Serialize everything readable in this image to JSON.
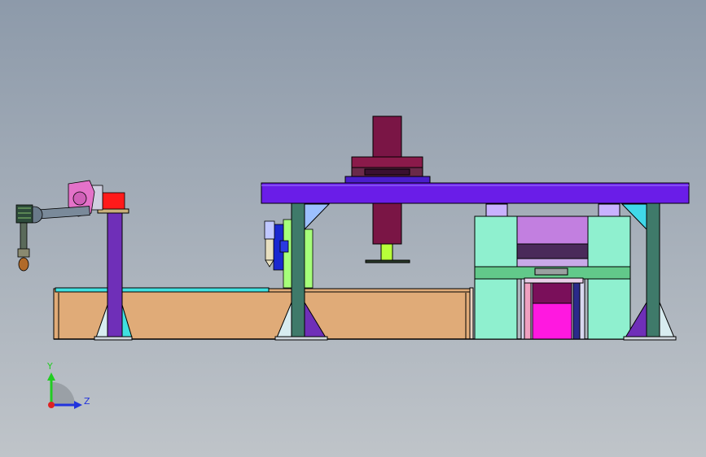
{
  "view": {
    "background_top": "#8d9aaa",
    "background_bottom": "#bfc4c9"
  },
  "triad": {
    "y_label": "Y",
    "z_label": "Z",
    "y_color": "#22cc22",
    "z_color": "#2233dd",
    "origin_color": "#dd2222"
  },
  "colors": {
    "gantry_beam": "#6a1de8",
    "base_tank": "#e0ab78",
    "tank_rim": "#40e0e0",
    "column_green": "#3f7a6a",
    "column_purple": "#6f2fb8",
    "press_mint": "#8ff0cf",
    "press_green": "#62c98a",
    "press_violet": "#c27fe0",
    "press_dark": "#4a2a5a",
    "press_magenta": "#ff18e0",
    "press_maroon": "#7a0f5a",
    "ram_maroon": "#7a1545",
    "ram_rod": "#b8ff3a",
    "robot_pink": "#e472c9",
    "robot_red": "#ff1a1a",
    "robot_grey": "#7a8a9a",
    "robot_blue": "#1a28d0",
    "light_blue": "#9cc0ff",
    "cylinder_lavender": "#c9b2ff"
  }
}
